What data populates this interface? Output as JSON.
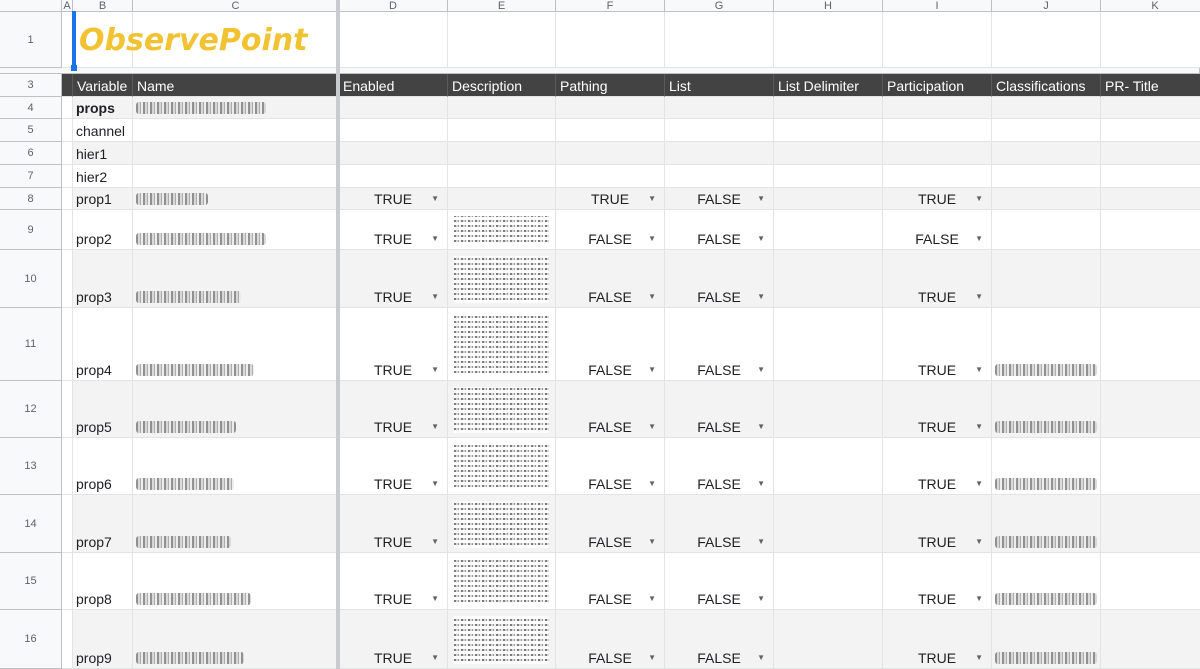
{
  "columns": [
    "A",
    "B",
    "C",
    "D",
    "E",
    "F",
    "G",
    "H",
    "I",
    "J",
    "K"
  ],
  "row_numbers": [
    "1",
    "3",
    "4",
    "5",
    "6",
    "7",
    "8",
    "9",
    "10",
    "11",
    "12",
    "13",
    "14",
    "15",
    "16"
  ],
  "title": "ObservePoint",
  "headers": [
    "Variable",
    "Name",
    "Enabled",
    "Description",
    "Pathing",
    "List",
    "List Delimiter",
    "Participation",
    "Classifications",
    "PR- Title"
  ],
  "rows": [
    {
      "variable": "props",
      "bold": true
    },
    {
      "variable": "channel"
    },
    {
      "variable": "hier1"
    },
    {
      "variable": "hier2"
    },
    {
      "variable": "prop1",
      "enabled": "TRUE",
      "pathing": "TRUE",
      "list": "FALSE",
      "participation": "TRUE"
    },
    {
      "variable": "prop2",
      "enabled": "TRUE",
      "pathing": "FALSE",
      "list": "FALSE",
      "participation": "FALSE"
    },
    {
      "variable": "prop3",
      "enabled": "TRUE",
      "pathing": "FALSE",
      "list": "FALSE",
      "participation": "TRUE"
    },
    {
      "variable": "prop4",
      "enabled": "TRUE",
      "pathing": "FALSE",
      "list": "FALSE",
      "participation": "TRUE"
    },
    {
      "variable": "prop5",
      "enabled": "TRUE",
      "pathing": "FALSE",
      "list": "FALSE",
      "participation": "TRUE"
    },
    {
      "variable": "prop6",
      "enabled": "TRUE",
      "pathing": "FALSE",
      "list": "FALSE",
      "participation": "TRUE"
    },
    {
      "variable": "prop7",
      "enabled": "TRUE",
      "pathing": "FALSE",
      "list": "FALSE",
      "participation": "TRUE"
    },
    {
      "variable": "prop8",
      "enabled": "TRUE",
      "pathing": "FALSE",
      "list": "FALSE",
      "participation": "TRUE"
    },
    {
      "variable": "prop9",
      "enabled": "TRUE",
      "pathing": "FALSE",
      "list": "FALSE",
      "participation": "TRUE"
    }
  ],
  "icons": {
    "dropdown": "dropdown-arrow-icon",
    "glyph": "▼"
  }
}
